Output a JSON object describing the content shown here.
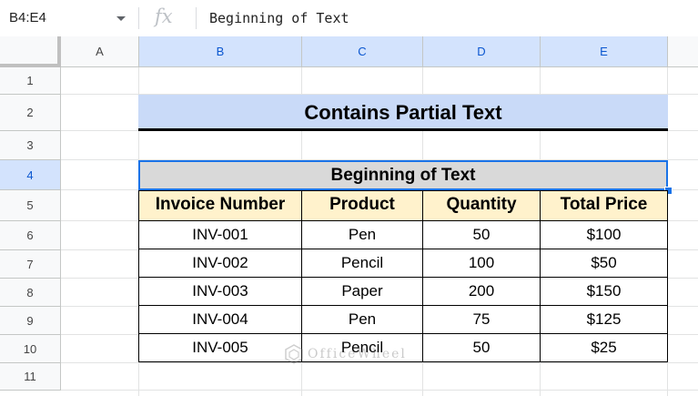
{
  "formula_bar": {
    "name_box": "B4:E4",
    "fx_label": "fx",
    "value": "Beginning of Text"
  },
  "columns": [
    "A",
    "B",
    "C",
    "D",
    "E"
  ],
  "rows": [
    "1",
    "2",
    "3",
    "4",
    "5",
    "6",
    "7",
    "8",
    "9",
    "10",
    "11"
  ],
  "sheet": {
    "title": "Contains Partial Text",
    "subtitle": "Beginning of Text",
    "table": {
      "headers": [
        "Invoice Number",
        "Product",
        "Quantity",
        "Total Price"
      ],
      "rows": [
        [
          "INV-001",
          "Pen",
          "50",
          "$100"
        ],
        [
          "INV-002",
          "Pencil",
          "100",
          "$50"
        ],
        [
          "INV-003",
          "Paper",
          "200",
          "$150"
        ],
        [
          "INV-004",
          "Pen",
          "75",
          "$125"
        ],
        [
          "INV-005",
          "Pencil",
          "50",
          "$25"
        ]
      ]
    }
  },
  "watermark": "OfficeWheel",
  "colors": {
    "title_fill": "#c9daf8",
    "subtitle_fill": "#d9d9d9",
    "header_fill": "#fff2cc",
    "selection": "#1a73e8"
  }
}
